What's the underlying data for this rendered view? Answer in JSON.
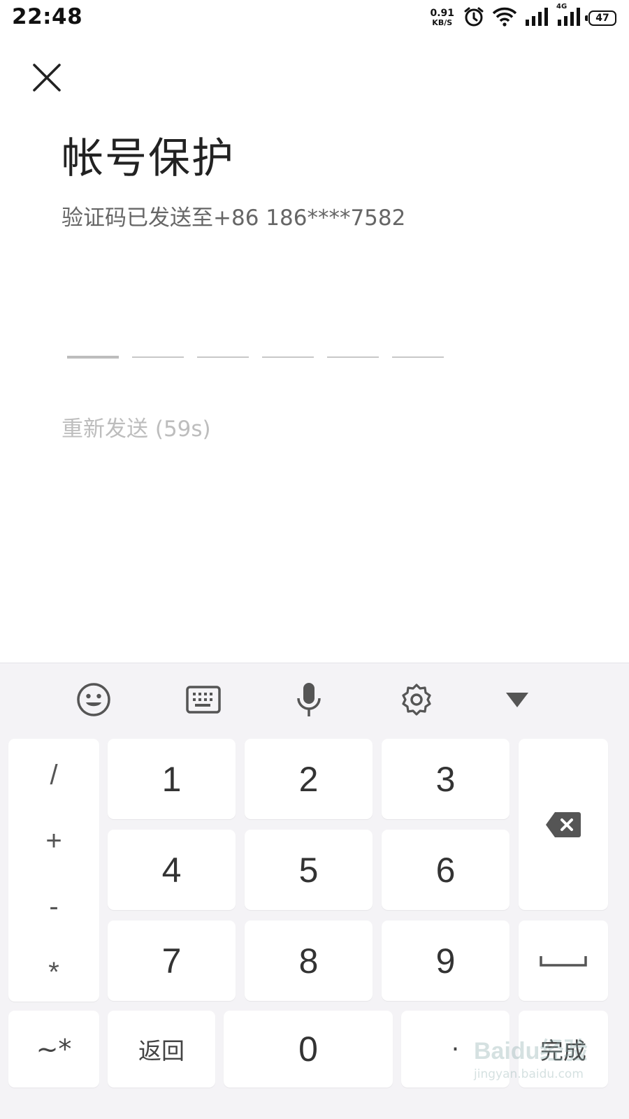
{
  "status_bar": {
    "time": "22:48",
    "net_speed_value": "0.91",
    "net_speed_unit": "KB/S",
    "network_type": "4G",
    "battery": "47",
    "icons": [
      "alarm-icon",
      "wifi-icon",
      "signal-icon",
      "signal-4g-icon",
      "battery-icon"
    ]
  },
  "page": {
    "close_icon": "close-icon",
    "title": "帐号保护",
    "subtitle": "验证码已发送至+86 186****7582",
    "code_length": 6,
    "resend": "重新发送 (59s)"
  },
  "keyboard": {
    "toolbar": [
      "emoji-icon",
      "keyboard-icon",
      "microphone-icon",
      "settings-icon",
      "collapse-icon"
    ],
    "symbols": [
      "/",
      "+",
      "-",
      "*"
    ],
    "digits": [
      "1",
      "2",
      "3",
      "4",
      "5",
      "6",
      "7",
      "8",
      "9"
    ],
    "bottom": {
      "sym_toggle": "~*",
      "back": "返回",
      "zero": "0",
      "dot": "·",
      "done": "完成"
    },
    "side_icons": [
      "backspace-icon",
      "space-icon"
    ]
  },
  "watermark": {
    "brand": "Baidu经验",
    "url": "jingyan.baidu.com"
  }
}
